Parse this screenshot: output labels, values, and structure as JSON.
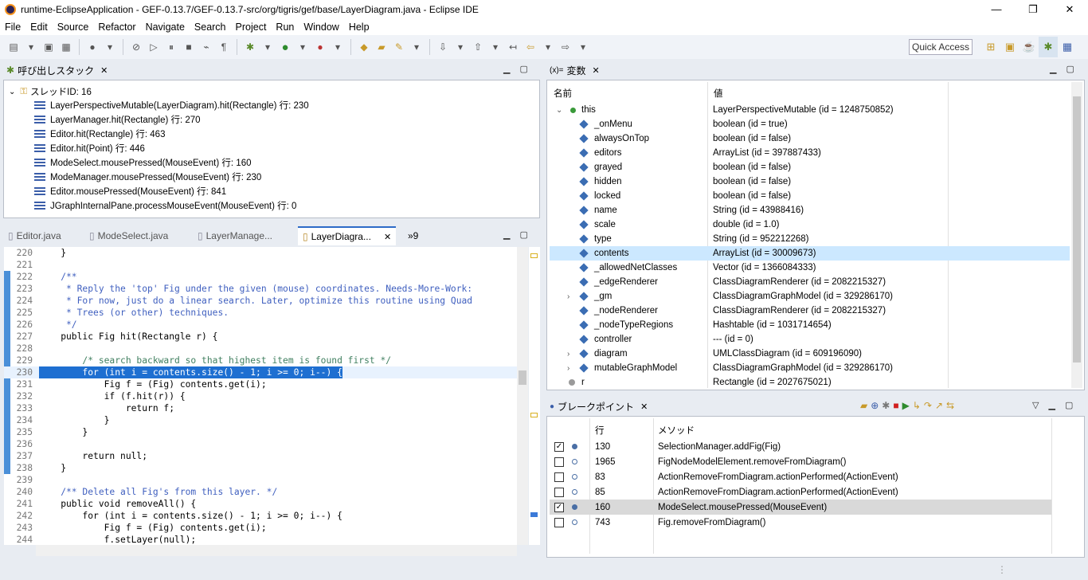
{
  "window": {
    "title": "runtime-EclipseApplication - GEF-0.13.7/GEF-0.13.7-src/org/tigris/gef/base/LayerDiagram.java - Eclipse IDE",
    "minimize": "—",
    "restore": "❐",
    "close": "✕"
  },
  "menu": [
    "File",
    "Edit",
    "Source",
    "Refactor",
    "Navigate",
    "Search",
    "Project",
    "Run",
    "Window",
    "Help"
  ],
  "toolbar": {
    "quick_access": "Quick Access"
  },
  "callstack": {
    "title": "呼び出しスタック",
    "thread": "スレッドID: 16",
    "frames": [
      "LayerPerspectiveMutable(LayerDiagram).hit(Rectangle) 行: 230",
      "LayerManager.hit(Rectangle) 行: 270",
      "Editor.hit(Rectangle) 行: 463",
      "Editor.hit(Point) 行: 446",
      "ModeSelect.mousePressed(MouseEvent) 行: 160",
      "ModeManager.mousePressed(MouseEvent) 行: 230",
      "Editor.mousePressed(MouseEvent) 行: 841",
      "JGraphInternalPane.processMouseEvent(MouseEvent) 行: 0"
    ]
  },
  "editor": {
    "tabs": [
      "Editor.java",
      "ModeSelect.java",
      "LayerManage...",
      "LayerDiagra..."
    ],
    "overflow": "»9",
    "lines": [
      {
        "n": "220",
        "t": "    }"
      },
      {
        "n": "221",
        "t": ""
      },
      {
        "n": "222",
        "t": "    /**"
      },
      {
        "n": "223",
        "t": "     * Reply the 'top' Fig under the given (mouse) coordinates. Needs-More-Work:"
      },
      {
        "n": "224",
        "t": "     * For now, just do a linear search. Later, optimize this routine using Quad"
      },
      {
        "n": "225",
        "t": "     * Trees (or other) techniques."
      },
      {
        "n": "226",
        "t": "     */"
      },
      {
        "n": "227",
        "t": "    public Fig hit(Rectangle r) {"
      },
      {
        "n": "228",
        "t": ""
      },
      {
        "n": "229",
        "t": "        /* search backward so that highest item is found first */"
      },
      {
        "n": "230",
        "t": "        for (int i = contents.size() - 1; i >= 0; i--) {"
      },
      {
        "n": "231",
        "t": "            Fig f = (Fig) contents.get(i);"
      },
      {
        "n": "232",
        "t": "            if (f.hit(r)) {"
      },
      {
        "n": "233",
        "t": "                return f;"
      },
      {
        "n": "234",
        "t": "            }"
      },
      {
        "n": "235",
        "t": "        }"
      },
      {
        "n": "236",
        "t": ""
      },
      {
        "n": "237",
        "t": "        return null;"
      },
      {
        "n": "238",
        "t": "    }"
      },
      {
        "n": "239",
        "t": ""
      },
      {
        "n": "240",
        "t": "    /** Delete all Fig's from this layer. */"
      },
      {
        "n": "241",
        "t": "    public void removeAll() {"
      },
      {
        "n": "242",
        "t": "        for (int i = contents.size() - 1; i >= 0; i--) {"
      },
      {
        "n": "243",
        "t": "            Fig f = (Fig) contents.get(i);"
      },
      {
        "n": "244",
        "t": "            f.setLayer(null);"
      }
    ]
  },
  "variables": {
    "title": "変数",
    "col_name": "名前",
    "col_value": "値",
    "rows": [
      {
        "name": "this",
        "value": "LayerPerspectiveMutable (id = 1248750852)",
        "exp": "⌄"
      },
      {
        "name": "_onMenu",
        "value": "boolean (id = true)",
        "exp": ""
      },
      {
        "name": "alwaysOnTop",
        "value": "boolean (id = false)",
        "exp": ""
      },
      {
        "name": "editors",
        "value": "ArrayList (id = 397887433)",
        "exp": ""
      },
      {
        "name": "grayed",
        "value": "boolean (id = false)",
        "exp": ""
      },
      {
        "name": "hidden",
        "value": "boolean (id = false)",
        "exp": ""
      },
      {
        "name": "locked",
        "value": "boolean (id = false)",
        "exp": ""
      },
      {
        "name": "name",
        "value": "String (id = 43988416)",
        "exp": ""
      },
      {
        "name": "scale",
        "value": "double (id = 1.0)",
        "exp": ""
      },
      {
        "name": "type",
        "value": "String (id = 952212268)",
        "exp": ""
      },
      {
        "name": "contents",
        "value": "ArrayList (id = 30009673)",
        "exp": ""
      },
      {
        "name": "_allowedNetClasses",
        "value": "Vector (id = 1366084333)",
        "exp": ""
      },
      {
        "name": "_edgeRenderer",
        "value": "ClassDiagramRenderer (id = 2082215327)",
        "exp": ""
      },
      {
        "name": "_gm",
        "value": "ClassDiagramGraphModel (id = 329286170)",
        "exp": "›"
      },
      {
        "name": "_nodeRenderer",
        "value": "ClassDiagramRenderer (id = 2082215327)",
        "exp": ""
      },
      {
        "name": "_nodeTypeRegions",
        "value": "Hashtable (id = 1031714654)",
        "exp": ""
      },
      {
        "name": "controller",
        "value": "--- (id = 0)",
        "exp": ""
      },
      {
        "name": "diagram",
        "value": "UMLClassDiagram (id = 609196090)",
        "exp": "›"
      },
      {
        "name": "mutableGraphModel",
        "value": "ClassDiagramGraphModel (id = 329286170)",
        "exp": "›"
      },
      {
        "name": "r",
        "value": "Rectangle (id = 2027675021)",
        "exp": ""
      }
    ]
  },
  "breakpoints": {
    "title": "ブレークポイント",
    "col_line": "行",
    "col_method": "メソッド",
    "rows": [
      {
        "line": "130",
        "method": "SelectionManager.addFig(Fig)",
        "checked": "✓"
      },
      {
        "line": "1965",
        "method": "FigNodeModelElement.removeFromDiagram()",
        "checked": ""
      },
      {
        "line": "83",
        "method": "ActionRemoveFromDiagram.actionPerformed(ActionEvent)",
        "checked": ""
      },
      {
        "line": "85",
        "method": "ActionRemoveFromDiagram.actionPerformed(ActionEvent)",
        "checked": ""
      },
      {
        "line": "160",
        "method": "ModeSelect.mousePressed(MouseEvent)",
        "checked": "✓"
      },
      {
        "line": "743",
        "method": "Fig.removeFromDiagram()",
        "checked": ""
      }
    ]
  },
  "colors": {
    "accent": "#1e6fd1",
    "selection_row": "#cce8ff",
    "bp_selected": "#d9d9d9"
  }
}
